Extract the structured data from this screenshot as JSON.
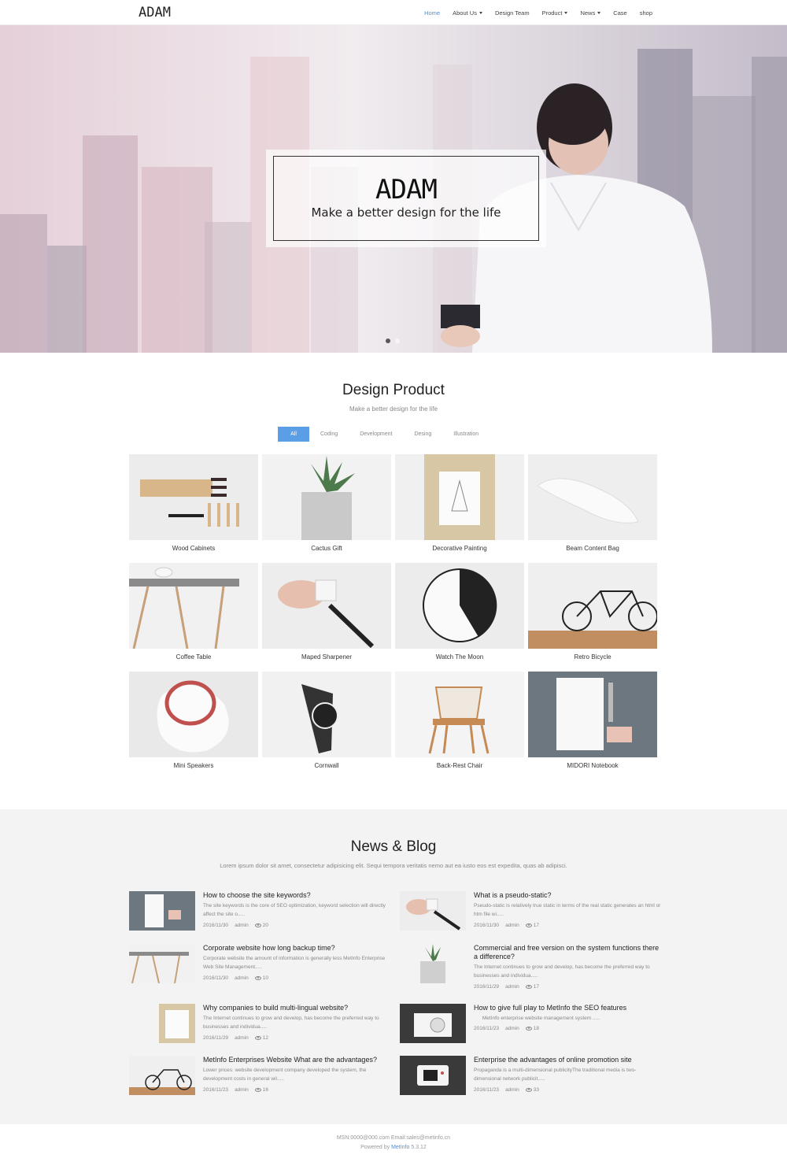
{
  "brand": "ADAM",
  "nav": {
    "items": [
      {
        "label": "Home",
        "active": true,
        "dropdown": false
      },
      {
        "label": "About Us",
        "active": false,
        "dropdown": true
      },
      {
        "label": "Design Team",
        "active": false,
        "dropdown": false
      },
      {
        "label": "Product",
        "active": false,
        "dropdown": true
      },
      {
        "label": "News",
        "active": false,
        "dropdown": true
      },
      {
        "label": "Case",
        "active": false,
        "dropdown": false
      },
      {
        "label": "shop",
        "active": false,
        "dropdown": false
      }
    ]
  },
  "hero": {
    "title": "ADAM",
    "subtitle": "Make a better design for the life",
    "slides": 2,
    "active_slide": 1
  },
  "products": {
    "title": "Design Product",
    "subtitle": "Make a better design for the life",
    "filters": [
      "All",
      "Coding",
      "Development",
      "Desing",
      "Illustration"
    ],
    "active_filter": "All",
    "items": [
      "Wood Cabinets",
      "Cactus Gift",
      "Decorative Painting",
      "Beam Content Bag",
      "Coffee Table",
      "Maped Sharpener",
      "Watch The Moon",
      "Retro Bicycle",
      "Mini Speakers",
      "Cornwall",
      "Back-Rest Chair",
      "MIDORI Notebook"
    ]
  },
  "news": {
    "title": "News & Blog",
    "subtitle": "Lorem ipsum dolor sit amet, consectetur adipisicing elit. Sequi tempora veritatis nemo aut ea iusto eos est expedita, quas ab adipisci.",
    "items": [
      {
        "title": "How to choose the site keywords?",
        "desc": "The site keywords is the core of SEO optimization, keyword selection will directly affect the site o.....",
        "date": "2016/11/30",
        "author": "admin",
        "views": "20"
      },
      {
        "title": "What is a pseudo-static?",
        "desc": "Pseudo-static is relatively true static in terms of the real static generates an html or htm file wi.....",
        "date": "2016/11/30",
        "author": "admin",
        "views": "17"
      },
      {
        "title": "Corporate website how long backup time?",
        "desc": "Corporate website the amount of information is generally less MetInfo Enterprise Web Site Management.....",
        "date": "2016/11/30",
        "author": "admin",
        "views": "10"
      },
      {
        "title": "Commercial and free version on the system functions there a difference?",
        "desc": "The Internet continues to grow and develop, has become the preferred way to businesses and individua.....",
        "date": "2016/11/29",
        "author": "admin",
        "views": "17"
      },
      {
        "title": "Why companies to build multi-lingual website?",
        "desc": "The Internet continues to grow and develop, has become the preferred way to businesses and individua.....",
        "date": "2016/11/29",
        "author": "admin",
        "views": "12"
      },
      {
        "title": "How to give full play to MetInfo the SEO features",
        "desc": "      MetInfo enterprise website management system .....",
        "date": "2016/11/23",
        "author": "admin",
        "views": "18"
      },
      {
        "title": "MetInfo Enterprises Website What are the advantages?",
        "desc": "Lower prices: website development company developed the system, the development costs in general wil.....",
        "date": "2016/11/23",
        "author": "admin",
        "views": "16"
      },
      {
        "title": "Enterprise the advantages of online promotion site",
        "desc": "Propaganda is a multi-dimensional publicityThe traditional media is two-dimensional network publicit.....",
        "date": "2016/11/23",
        "author": "admin",
        "views": "33"
      }
    ]
  },
  "footer": {
    "contact": "MSN:0000@000.com Email:sales@metinfo.cn",
    "powered_prefix": "Powered by ",
    "powered_link": "MetInfo",
    "version": " 5.3.12"
  },
  "colors": {
    "accent": "#4a90e2",
    "filter_active": "#5a9ee6",
    "news_bg": "#f3f3f3"
  }
}
